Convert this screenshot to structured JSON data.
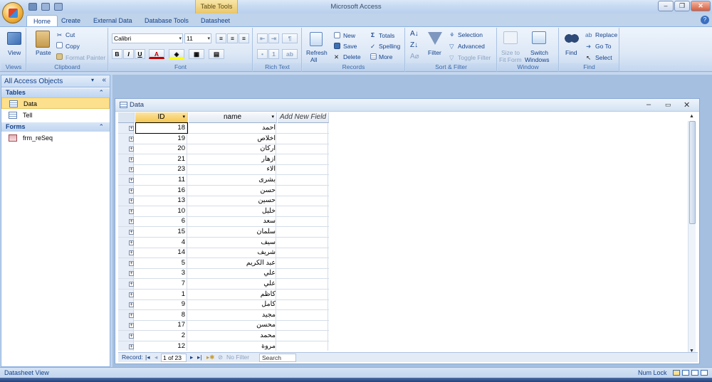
{
  "window": {
    "title": "Microsoft Access",
    "context_tab_group": "Table Tools"
  },
  "ribbon_tabs": [
    {
      "label": "Home",
      "active": true
    },
    {
      "label": "Create",
      "active": false
    },
    {
      "label": "External Data",
      "active": false
    },
    {
      "label": "Database Tools",
      "active": false
    },
    {
      "label": "Datasheet",
      "active": false
    }
  ],
  "groups": {
    "views": {
      "label": "Views",
      "view": "View"
    },
    "clipboard": {
      "label": "Clipboard",
      "paste": "Paste",
      "cut": "Cut",
      "copy": "Copy",
      "format_painter": "Format Painter"
    },
    "font": {
      "label": "Font",
      "font_name": "Calibri",
      "font_size": "11",
      "bold": "B",
      "italic": "I",
      "underline": "U",
      "font_color": "A"
    },
    "rich_text": {
      "label": "Rich Text"
    },
    "records": {
      "label": "Records",
      "refresh": "Refresh",
      "refresh_sub": "All",
      "new": "New",
      "save": "Save",
      "delete": "Delete",
      "totals": "Totals",
      "spelling": "Spelling",
      "more": "More"
    },
    "sort_filter": {
      "label": "Sort & Filter",
      "filter": "Filter",
      "selection": "Selection",
      "advanced": "Advanced",
      "toggle_filter": "Toggle Filter"
    },
    "window": {
      "label": "Window",
      "size_to_fit": "Size to",
      "size_to_fit2": "Fit Form",
      "switch": "Switch",
      "switch2": "Windows"
    },
    "find": {
      "label": "Find",
      "find": "Find",
      "replace": "Replace",
      "goto": "Go To",
      "select": "Select"
    }
  },
  "nav": {
    "header": "All Access Objects",
    "sections": [
      {
        "title": "Tables",
        "items": [
          {
            "label": "Data",
            "selected": true
          },
          {
            "label": "Tell",
            "selected": false
          }
        ]
      },
      {
        "title": "Forms",
        "items": [
          {
            "label": "frm_reSeq",
            "selected": false
          }
        ]
      }
    ]
  },
  "datasheet": {
    "title": "Data",
    "columns": [
      "ID",
      "name",
      "Add New Field"
    ],
    "rows": [
      {
        "id": "18",
        "name": "احمد"
      },
      {
        "id": "19",
        "name": "اخلاص"
      },
      {
        "id": "20",
        "name": "اركان"
      },
      {
        "id": "21",
        "name": "ازهار"
      },
      {
        "id": "23",
        "name": "الاء"
      },
      {
        "id": "11",
        "name": "بشرى"
      },
      {
        "id": "16",
        "name": "حسن"
      },
      {
        "id": "13",
        "name": "حسين"
      },
      {
        "id": "10",
        "name": "خليل"
      },
      {
        "id": "6",
        "name": "سعد"
      },
      {
        "id": "15",
        "name": "سلمان"
      },
      {
        "id": "4",
        "name": "سيف"
      },
      {
        "id": "14",
        "name": "شريف"
      },
      {
        "id": "5",
        "name": "عبد الكريم"
      },
      {
        "id": "3",
        "name": "علي"
      },
      {
        "id": "7",
        "name": "علي"
      },
      {
        "id": "1",
        "name": "كاظم"
      },
      {
        "id": "9",
        "name": "كامل"
      },
      {
        "id": "8",
        "name": "مجيد"
      },
      {
        "id": "17",
        "name": "محسن"
      },
      {
        "id": "2",
        "name": "محمد"
      },
      {
        "id": "12",
        "name": "مروة"
      }
    ]
  },
  "record_bar": {
    "label": "Record:",
    "position": "1 of 23",
    "filter": "No Filter",
    "search": "Search"
  },
  "status": {
    "left": "Datasheet View",
    "right": "Num Lock"
  }
}
